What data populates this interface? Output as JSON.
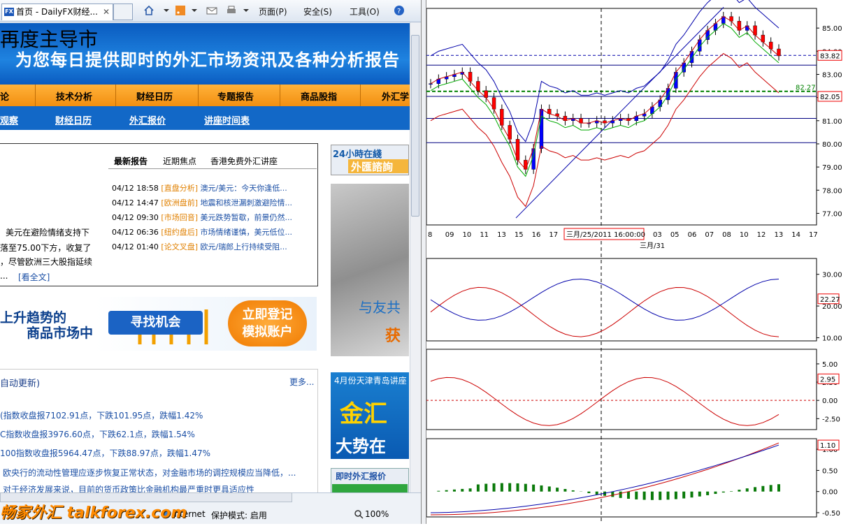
{
  "browser": {
    "tab_title": "首页 - DailyFX财经...",
    "tab_close": "✕",
    "toolbar": {
      "page": "页面(P)",
      "safety": "安全(S)",
      "tools": "工具(O)"
    },
    "banner": "为您每日提供即时的外汇市场资讯及各种分析报告",
    "nav1": [
      "论",
      "技术分析",
      "财经日历",
      "专题报告",
      "商品股指",
      "外汇学"
    ],
    "nav2": [
      "观察",
      "财经日历",
      "外汇报价",
      "讲座时间表"
    ],
    "feature": {
      "headline": "再度主导市",
      "line1": "美元在避险情绪支持下",
      "line2": "落至75.00下方，收复了",
      "line3": "，尽管欧洲三大股指延续",
      "more_link": "[看全文]",
      "ellipsis": "..."
    },
    "report_tabs": [
      "最新报告",
      "近期焦点",
      "香港免费外汇讲座"
    ],
    "reports": [
      {
        "date": "04/12 18:58",
        "cat": "[直盘分析]",
        "title": "澳元/美元：今天你逢低..."
      },
      {
        "date": "04/12 14:47",
        "cat": "[欧洲盘前]",
        "title": "地震和核泄漏刺激避险情..."
      },
      {
        "date": "04/12 09:30",
        "cat": "[市场回音]",
        "title": "美元跌势暂歇，前景仍然..."
      },
      {
        "date": "04/12 06:36",
        "cat": "[纽约盘后]",
        "title": "市场情绪谨慎，美元低位..."
      },
      {
        "date": "04/12 01:40",
        "cat": "[论文叉盘]",
        "title": "欧元/瑞郎上行持续受阻..."
      }
    ],
    "promo": {
      "line1": "上升趋势的",
      "line2": "商品市场中",
      "find": "寻找机会",
      "register1": "立即登记",
      "register2": "模拟账户"
    },
    "news": {
      "header": "自动更新)",
      "more": "更多...",
      "items": [
        "(指数收盘报7102.91点，下跌101.95点，跌幅1.42%",
        "C指数收盘报3976.60点，下跌62.1点，跌幅1.54%",
        "100指数收盘报5964.47点，下跌88.97点，跌幅1.47%",
        "欧央行的流动性管理应逐步恢复正常状态，对金融市场的调控规模应当降低，...",
        "对于经济发展来说，目前的货币政策比金融机构最严重时更具适应性"
      ]
    },
    "ads": {
      "a1_top": "24小時在綫",
      "a1_bottom": "外匯諮詢",
      "a2_text": "与友共",
      "a2_big": "获",
      "a3_top": "4月份天津青岛讲座",
      "a3_big": "金汇",
      "a3_bottom": "大势在",
      "quotes": "即时外汇报价"
    },
    "status": {
      "internet": "Internet",
      "protect": "保护模式: 启用",
      "zoom": "100%"
    },
    "watermark": "畅家外汇 talkforex.com"
  },
  "chart_data": [
    {
      "type": "candlestick",
      "title": "",
      "y_ticks": [
        "85.00",
        "84.00",
        "83.00",
        "82.00",
        "81.00",
        "80.00",
        "79.00",
        "78.00",
        "77.00"
      ],
      "price_labels": [
        "83.82",
        "82.05"
      ],
      "level_label": "82.27",
      "x_ticks": [
        "8",
        "09",
        "10",
        "11",
        "13",
        "15",
        "16",
        "17",
        "18",
        "20",
        "22",
        "31",
        "01",
        "03",
        "05",
        "06",
        "07",
        "08",
        "10",
        "12",
        "13",
        "14",
        "17"
      ],
      "crosshair_label": "三月/25/2011 16:00:00",
      "month_label": "三月/31",
      "horizontal_levels": [
        83.82,
        83.4,
        82.05,
        81.1,
        80.05
      ],
      "close_series": [
        82.6,
        82.8,
        82.9,
        83.0,
        83.1,
        82.7,
        82.3,
        82.0,
        81.5,
        80.8,
        80.2,
        79.3,
        78.9,
        79.8,
        81.5,
        81.3,
        81.2,
        81.0,
        81.1,
        80.9,
        80.9,
        81.0,
        80.9,
        81.0,
        81.1,
        81.0,
        81.2,
        81.3,
        81.6,
        81.9,
        82.4,
        83.1,
        83.5,
        84.0,
        84.5,
        84.9,
        85.2,
        85.5,
        85.3,
        84.9,
        85.1,
        84.7,
        84.4,
        84.1,
        83.8
      ]
    },
    {
      "type": "line",
      "y_ticks": [
        "30.00",
        "20.00",
        "10.00"
      ],
      "value_label": "22.27"
    },
    {
      "type": "line",
      "y_ticks": [
        "5.00",
        "2.50",
        "0.00",
        "-2.50"
      ],
      "value_label": "2.95"
    },
    {
      "type": "bar",
      "y_ticks": [
        "1.00",
        "0.50",
        "0.00",
        "-0.50"
      ],
      "value_label": "1.10"
    }
  ],
  "colors": {
    "up": "#0000ff",
    "down": "#ff0000",
    "level": "#008000",
    "banner": "#0a5bbf",
    "nav": "#f7a020"
  }
}
